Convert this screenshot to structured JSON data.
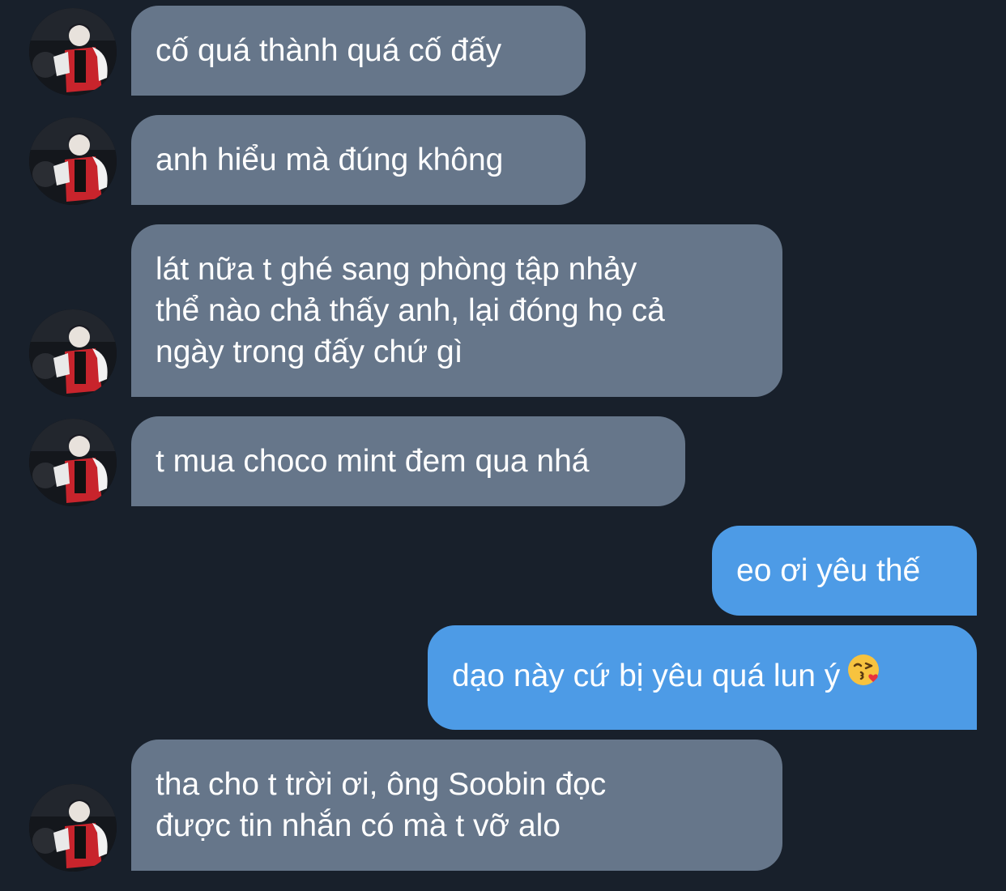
{
  "colors": {
    "background": "#18202b",
    "incoming_bubble": "#66768a",
    "outgoing_bubble": "#4d9be6",
    "text": "#ffffff"
  },
  "contact": {
    "avatar_icon": "profile-photo-avatar"
  },
  "messages": [
    {
      "direction": "incoming",
      "lines": [
        "cố quá thành quá cố đấy"
      ]
    },
    {
      "direction": "incoming",
      "lines": [
        "anh hiểu mà đúng không"
      ]
    },
    {
      "direction": "incoming",
      "lines": [
        "lát nữa t ghé sang phòng tập nhảy",
        "thể nào chả thấy anh, lại đóng họ cả",
        "ngày trong đấy chứ gì"
      ]
    },
    {
      "direction": "incoming",
      "lines": [
        "t mua choco mint đem qua nhá"
      ]
    },
    {
      "direction": "outgoing",
      "lines": [
        "eo ơi yêu thế"
      ]
    },
    {
      "direction": "outgoing",
      "lines": [
        "dạo này cứ bị yêu quá lun ý"
      ],
      "emoji": "face-blowing-kiss-icon"
    },
    {
      "direction": "incoming",
      "lines": [
        "tha cho t trời ơi, ông Soobin đọc",
        "được tin nhắn có mà t vỡ alo"
      ]
    }
  ]
}
